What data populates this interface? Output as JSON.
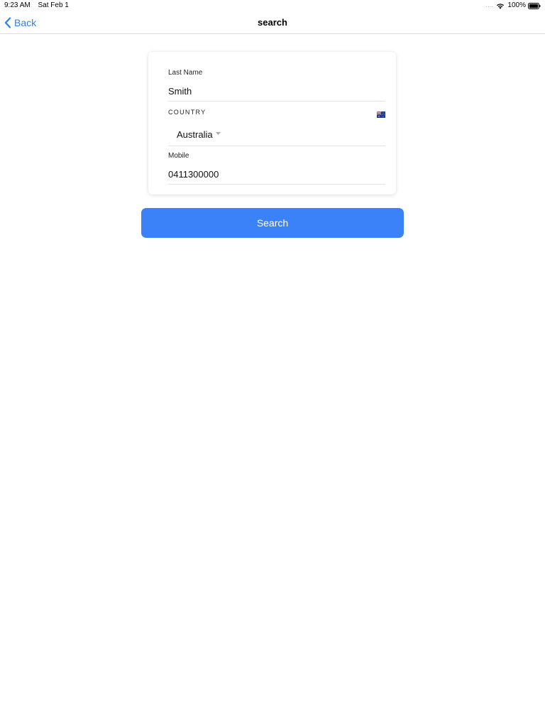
{
  "status_bar": {
    "time": "9:23 AM",
    "date": "Sat Feb 1",
    "battery_percent": "100%",
    "signal_icon": "signal-dots-icon",
    "wifi_icon": "wifi-icon",
    "battery_icon": "battery-icon"
  },
  "nav": {
    "back_label": "Back",
    "back_icon": "chevron-left-icon",
    "title": "search"
  },
  "form": {
    "last_name": {
      "label": "Last Name",
      "value": "Smith"
    },
    "country": {
      "label": "COUNTRY",
      "flag_icon": "australia-flag-icon",
      "selected": "Australia"
    },
    "mobile": {
      "label": "Mobile",
      "value": "0411300000"
    }
  },
  "search_button": {
    "label": "Search"
  },
  "colors": {
    "accent": "#3b82f8",
    "link": "#2f7ff0"
  }
}
